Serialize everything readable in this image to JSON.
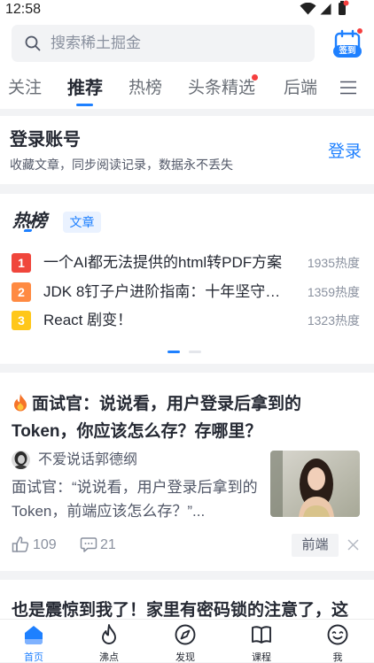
{
  "status_bar": {
    "time": "12:58",
    "icons": [
      "wifi-icon",
      "signal-icon",
      "battery-icon"
    ]
  },
  "search": {
    "placeholder": "搜索稀土掘金",
    "icon": "search-icon"
  },
  "checkin": {
    "label": "签到",
    "icon": "calendar-icon",
    "has_notification": true
  },
  "tabs": [
    {
      "label": "关注",
      "active": false
    },
    {
      "label": "推荐",
      "active": true
    },
    {
      "label": "热榜",
      "active": false
    },
    {
      "label": "头条精选",
      "active": false,
      "has_dot": true
    },
    {
      "label": "后端",
      "active": false
    }
  ],
  "tabs_menu_icon": "menu-icon",
  "login_card": {
    "title": "登录账号",
    "subtitle": "收藏文章，同步阅读记录，数据永不丢失",
    "action": "登录"
  },
  "hot_list": {
    "logo": "热榜",
    "tag": "文章",
    "items": [
      {
        "rank": "1",
        "title": "一个AI都无法提供的html转PDF方案",
        "heat": "1935热度"
      },
      {
        "rank": "2",
        "title": "JDK 8钉子户进阶指南：十年坚守…",
        "heat": "1359热度"
      },
      {
        "rank": "3",
        "title": "React 剧变！",
        "heat": "1323热度"
      }
    ],
    "pagination": {
      "current": 1,
      "total": 2
    }
  },
  "article": {
    "title_icon": "fire-icon",
    "title": "面试官：说说看，用户登录后拿到的 Token，你应该怎么存？存哪里？",
    "author": "不爱说话郭德纲",
    "excerpt": "面试官：“说说看，用户登录后拿到的 Token，前端应该怎么存？”...",
    "likes": "109",
    "comments": "21",
    "tag": "前端"
  },
  "next_article": {
    "title": "也是震惊到我了！家里有密码锁的注意了，这"
  },
  "bottom_nav": [
    {
      "label": "首页",
      "icon": "home-icon",
      "active": true
    },
    {
      "label": "沸点",
      "icon": "flame-icon",
      "active": false
    },
    {
      "label": "发现",
      "icon": "compass-icon",
      "active": false
    },
    {
      "label": "课程",
      "icon": "book-icon",
      "active": false
    },
    {
      "label": "我",
      "icon": "smile-face-icon",
      "active": false
    }
  ],
  "colors": {
    "brand_blue": "#1e80ff",
    "text_primary": "#252933",
    "text_secondary": "#8a919f",
    "rank_1": "#f0463c",
    "rank_2": "#ff8a42",
    "rank_3": "#ffc71a",
    "notification_red": "#f53f3f"
  }
}
